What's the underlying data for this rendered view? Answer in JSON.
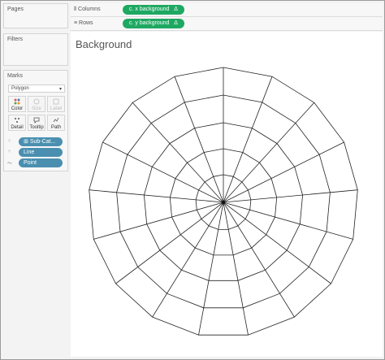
{
  "panels": {
    "pages": "Pages",
    "filters": "Filters",
    "marks": "Marks"
  },
  "marks": {
    "type": "Polygon",
    "buttons": {
      "color": "Color",
      "size": "Size",
      "label": "Label",
      "detail": "Detail",
      "tooltip": "Tooltip",
      "path": "Path"
    },
    "pills": [
      {
        "label": "Sub-Cat..."
      },
      {
        "label": "Line"
      },
      {
        "label": "Point"
      }
    ]
  },
  "shelves": {
    "columns": {
      "label": "Columns",
      "pill": "c. x background",
      "delta": "Δ"
    },
    "rows": {
      "label": "Rows",
      "pill": "c. y background",
      "delta": "Δ"
    }
  },
  "view": {
    "title": "Background"
  },
  "colors": {
    "accent_green": "#1fa862",
    "pill_blue": "#4a8fb0"
  }
}
